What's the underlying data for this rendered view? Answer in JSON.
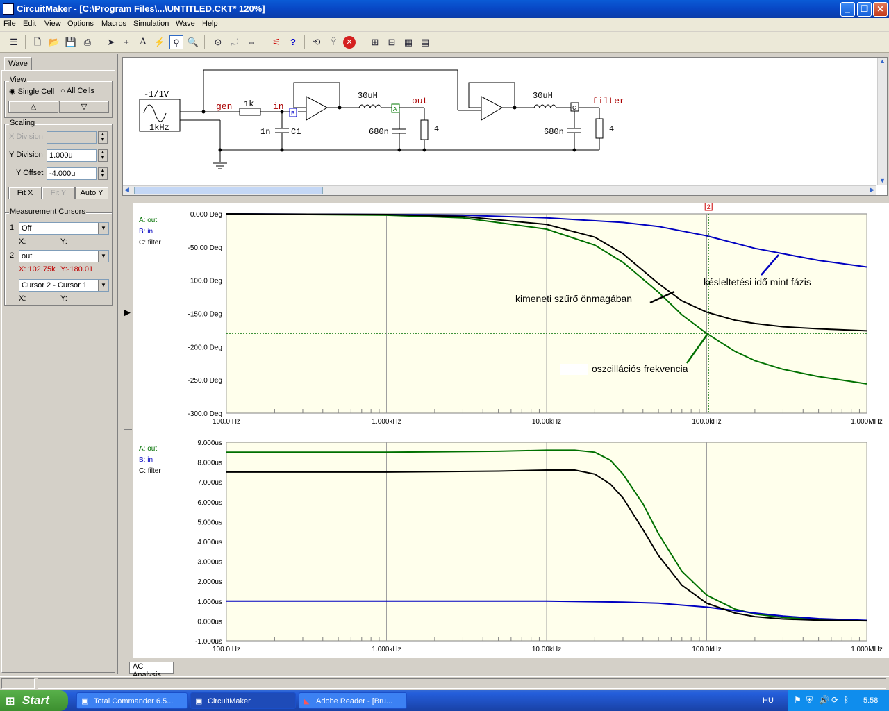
{
  "window": {
    "title": "CircuitMaker - [C:\\Program Files\\...\\UNTITLED.CKT* 120%]"
  },
  "menu": [
    "File",
    "Edit",
    "View",
    "Options",
    "Macros",
    "Simulation",
    "Wave",
    "Help"
  ],
  "left_panel": {
    "tab": "Wave",
    "view": {
      "legend": "View",
      "single_cell": "Single Cell",
      "all_cells": "All Cells",
      "selected": "Single Cell"
    },
    "scaling": {
      "legend": "Scaling",
      "x_division_label": "X Division",
      "x_division_value": "",
      "y_division_label": "Y Division",
      "y_division_value": "1.000u",
      "y_offset_label": "Y Offset",
      "y_offset_value": "-4.000u",
      "fit_x": "Fit X",
      "fit_y": "Fit Y",
      "auto_y": "Auto Y"
    },
    "cursors": {
      "legend": "Measurement Cursors",
      "c1_num": "1",
      "c1_value": "Off",
      "c1_x": "X:",
      "c1_y": "Y:",
      "c2_num": "2",
      "c2_value": "out",
      "c2_x": "X: 102.75k",
      "c2_y": "Y:-180.01",
      "diff_value": "Cursor 2 - Cursor 1",
      "diff_x": "X:",
      "diff_y": "Y:"
    }
  },
  "schematic": {
    "source_label": "-1/1V",
    "source_freq": "1kHz",
    "net_gen": "gen",
    "r1": "1k",
    "net_in": "in",
    "c1_val": "1n",
    "c1_name": "C1",
    "l1": "30uH",
    "c2": "680n",
    "net_out": "out",
    "r2": "4",
    "l2": "30uH",
    "c3": "680n",
    "net_filter": "filter",
    "r3": "4",
    "probe_b": "B",
    "probe_a": "A",
    "probe_c": "C"
  },
  "plots": {
    "cursor_marker": "2",
    "legend": [
      "A: out",
      "B: in",
      "C: filter"
    ],
    "top_annotations": {
      "blue": "késleltetési idő mint fázis",
      "black": "kimeneti szűrő önmagában",
      "green": "oszcillációs frekvencia"
    }
  },
  "chart_data": [
    {
      "type": "line",
      "xscale": "log",
      "xlim": [
        100,
        1000000
      ],
      "ylim": [
        -300,
        0
      ],
      "xticks": [
        "100.0 Hz",
        "1.000kHz",
        "10.00kHz",
        "100.0kHz",
        "1.000MHz"
      ],
      "yticks": [
        "0.000 Deg",
        "-50.00 Deg",
        "-100.0 Deg",
        "-150.0 Deg",
        "-200.0 Deg",
        "-250.0 Deg",
        "-300.0 Deg"
      ],
      "grid": true,
      "cursor_x": 102750,
      "cursor_y": -180.01,
      "series": [
        {
          "name": "A: out",
          "color": "#007000",
          "x": [
            100,
            1000,
            3000,
            10000,
            20000,
            30000,
            50000,
            70000,
            100000,
            150000,
            200000,
            300000,
            500000,
            1000000
          ],
          "values": [
            0,
            -2,
            -6,
            -23,
            -47,
            -73,
            -118,
            -152,
            -180,
            -207,
            -221,
            -234,
            -245,
            -256
          ]
        },
        {
          "name": "B: in",
          "color": "#0000c0",
          "x": [
            100,
            1000,
            3000,
            10000,
            30000,
            50000,
            100000,
            200000,
            300000,
            500000,
            1000000
          ],
          "values": [
            0,
            -1,
            -2,
            -6,
            -13,
            -19,
            -33,
            -52,
            -60,
            -70,
            -80
          ]
        },
        {
          "name": "C: filter",
          "color": "#000000",
          "x": [
            100,
            1000,
            3000,
            10000,
            20000,
            30000,
            50000,
            70000,
            100000,
            150000,
            200000,
            300000,
            500000,
            1000000
          ],
          "values": [
            0,
            -1,
            -4,
            -16,
            -35,
            -60,
            -105,
            -131,
            -148,
            -160,
            -165,
            -170,
            -173,
            -176
          ]
        }
      ]
    },
    {
      "type": "line",
      "xscale": "log",
      "xlim": [
        100,
        1000000
      ],
      "ylim": [
        -1,
        9
      ],
      "xticks": [
        "100.0 Hz",
        "1.000kHz",
        "10.00kHz",
        "100.0kHz",
        "1.000MHz"
      ],
      "yticks": [
        "9.000us",
        "8.000us",
        "7.000us",
        "6.000us",
        "5.000us",
        "4.000us",
        "3.000us",
        "2.000us",
        "1.000us",
        "0.000us",
        "-1.000us"
      ],
      "grid": true,
      "series": [
        {
          "name": "A: out",
          "color": "#007000",
          "x": [
            100,
            1000,
            5000,
            10000,
            15000,
            20000,
            25000,
            30000,
            40000,
            50000,
            70000,
            100000,
            150000,
            200000,
            300000,
            500000,
            1000000
          ],
          "values": [
            8.5,
            8.5,
            8.55,
            8.6,
            8.6,
            8.5,
            8.1,
            7.4,
            5.9,
            4.4,
            2.5,
            1.3,
            0.6,
            0.35,
            0.18,
            0.08,
            0.02
          ]
        },
        {
          "name": "B: in",
          "color": "#0000c0",
          "x": [
            100,
            1000,
            10000,
            30000,
            50000,
            100000,
            200000,
            300000,
            500000,
            1000000
          ],
          "values": [
            1.0,
            1.0,
            1.0,
            0.95,
            0.9,
            0.7,
            0.4,
            0.25,
            0.12,
            0.03
          ]
        },
        {
          "name": "C: filter",
          "color": "#000000",
          "x": [
            100,
            1000,
            5000,
            10000,
            15000,
            20000,
            25000,
            30000,
            40000,
            50000,
            70000,
            100000,
            150000,
            200000,
            300000,
            500000,
            1000000
          ],
          "values": [
            7.5,
            7.5,
            7.55,
            7.6,
            7.6,
            7.4,
            6.9,
            6.2,
            4.6,
            3.3,
            1.8,
            0.9,
            0.4,
            0.22,
            0.1,
            0.04,
            0.01
          ]
        }
      ]
    }
  ],
  "bottom_tab": "AC Analysis",
  "taskbar": {
    "start": "Start",
    "tasks": [
      "Total Commander 6.5...",
      "CircuitMaker",
      "Adobe Reader - [Bru..."
    ],
    "lang": "HU",
    "clock": "5:58"
  }
}
